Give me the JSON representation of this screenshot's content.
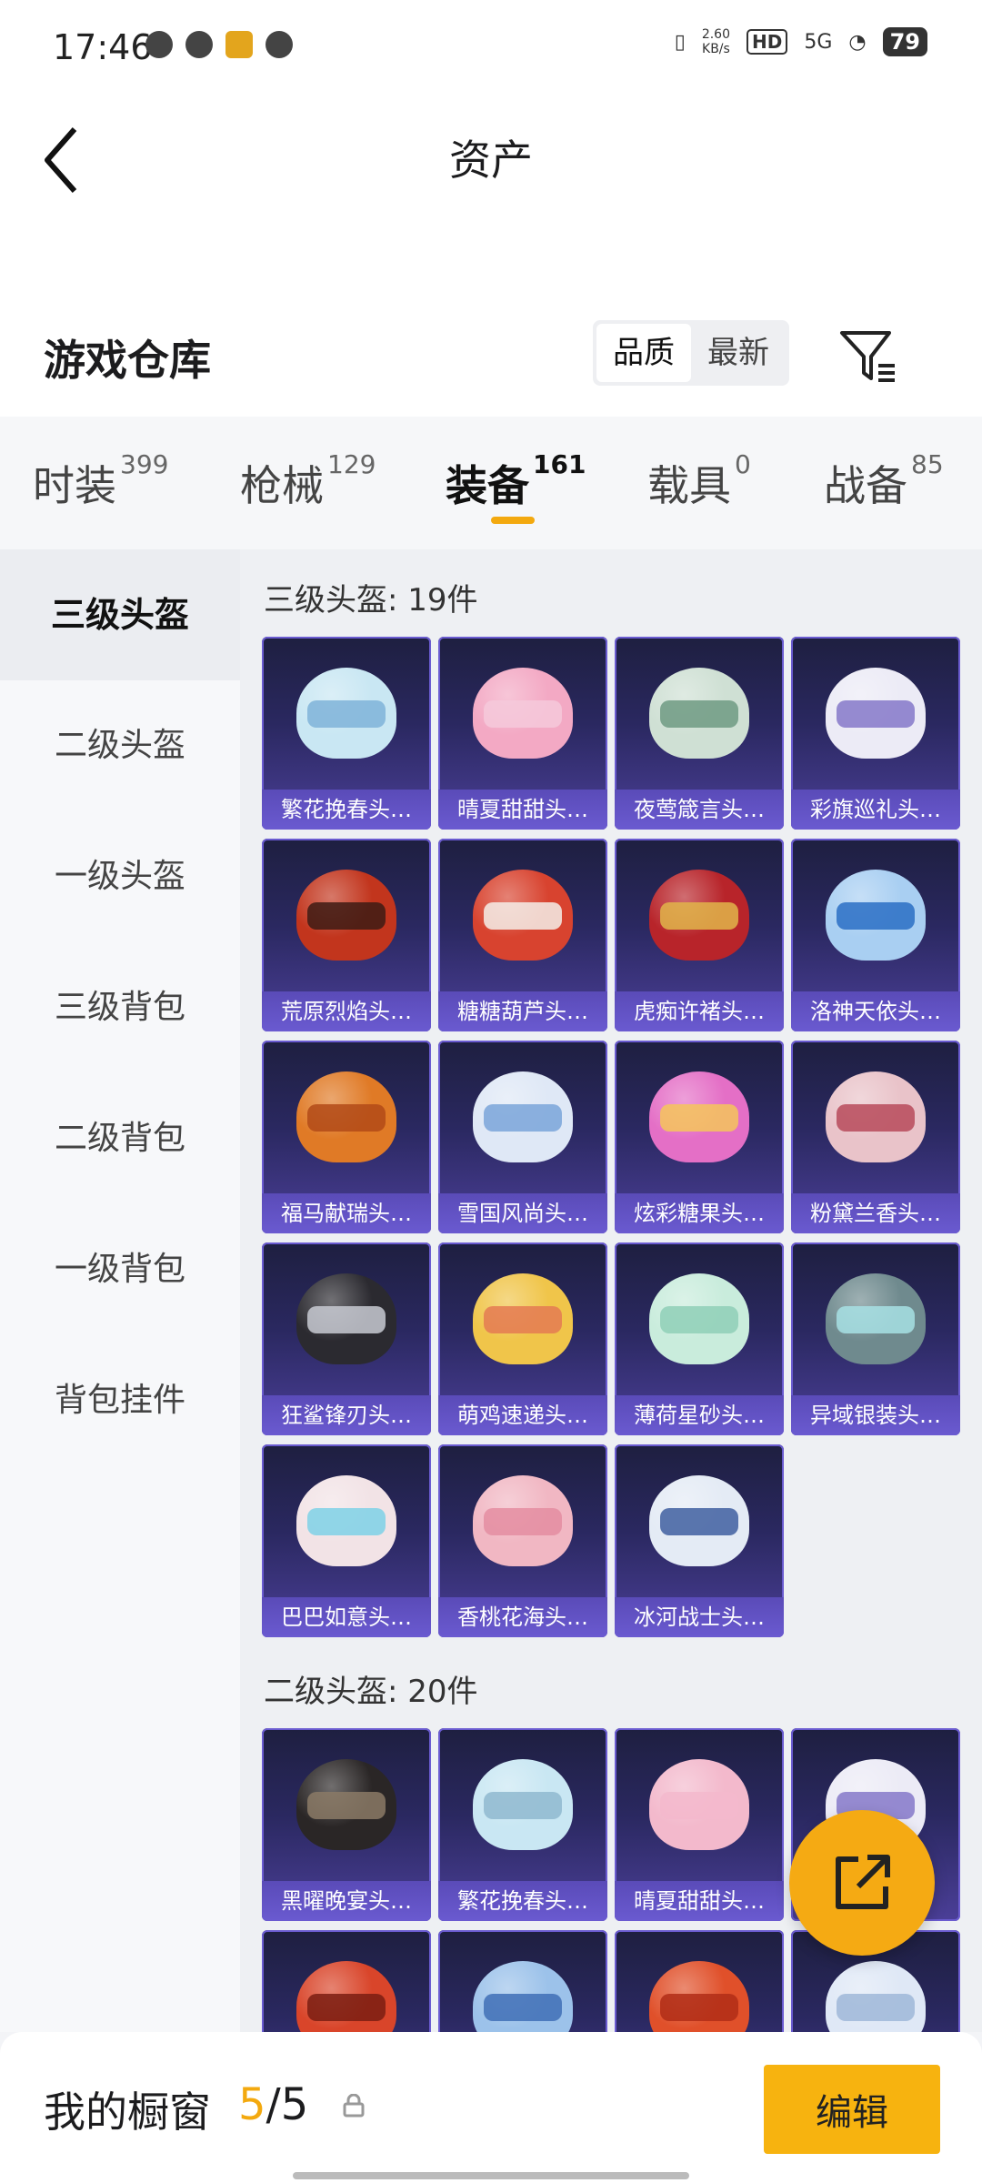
{
  "status": {
    "time": "17:46",
    "net_speed": "2.60",
    "net_unit": "KB/s",
    "hd": "HD",
    "signal": "5G",
    "battery": "79"
  },
  "header": {
    "title": "资产"
  },
  "warehouse": {
    "name": "游戏仓库",
    "sort_quality": "品质",
    "sort_latest": "最新"
  },
  "tabs": [
    {
      "label": "时装",
      "count": "399"
    },
    {
      "label": "枪械",
      "count": "129"
    },
    {
      "label": "装备",
      "count": "161"
    },
    {
      "label": "载具",
      "count": "0"
    },
    {
      "label": "战备",
      "count": "85"
    }
  ],
  "sidebar": [
    {
      "label": "三级头盔"
    },
    {
      "label": "二级头盔"
    },
    {
      "label": "一级头盔"
    },
    {
      "label": "三级背包"
    },
    {
      "label": "二级背包"
    },
    {
      "label": "一级背包"
    },
    {
      "label": "背包挂件"
    }
  ],
  "sections": [
    {
      "title": "三级头盔: 19件",
      "items": [
        {
          "name": "繁花挽春头…",
          "color": "#c9e7f3",
          "visor": "#7fb3d8"
        },
        {
          "name": "晴夏甜甜头…",
          "color": "#f3a9c4",
          "visor": "#f5c9db"
        },
        {
          "name": "夜莺箴言头…",
          "color": "#cfe0d4",
          "visor": "#6f9a82"
        },
        {
          "name": "彩旗巡礼头…",
          "color": "#ecebf6",
          "visor": "#8578c9"
        },
        {
          "name": "荒原烈焰头…",
          "color": "#c2351d",
          "visor": "#3d1b14"
        },
        {
          "name": "糖糖葫芦头…",
          "color": "#d8432f",
          "visor": "#f4efe9"
        },
        {
          "name": "虎痴许褚头…",
          "color": "#b8242a",
          "visor": "#e1b54a"
        },
        {
          "name": "洛神天依头…",
          "color": "#a9cff2",
          "visor": "#2a6fc4"
        },
        {
          "name": "福马献瑞头…",
          "color": "#e07a26",
          "visor": "#b24a18"
        },
        {
          "name": "雪国风尚头…",
          "color": "#dfe8f6",
          "visor": "#7aa4d9"
        },
        {
          "name": "炫彩糖果头…",
          "color": "#e46fc6",
          "visor": "#f4c55b"
        },
        {
          "name": "粉黛兰香头…",
          "color": "#e9c3c9",
          "visor": "#b74a5a"
        },
        {
          "name": "狂鲨锋刃头…",
          "color": "#2b2a30",
          "visor": "#c8cad2"
        },
        {
          "name": "萌鸡速递头…",
          "color": "#f0c54a",
          "visor": "#e47a52"
        },
        {
          "name": "薄荷星砂头…",
          "color": "#c9ecdc",
          "visor": "#8fcfb7"
        },
        {
          "name": "异域银装头…",
          "color": "#6f8a8e",
          "visor": "#a7e0e4"
        },
        {
          "name": "巴巴如意头…",
          "color": "#f2e3e6",
          "visor": "#7ed1e6"
        },
        {
          "name": "香桃花海头…",
          "color": "#f1b7c3",
          "visor": "#e48da1"
        },
        {
          "name": "冰河战士头…",
          "color": "#e4ebf5",
          "visor": "#3f5fa0"
        }
      ]
    },
    {
      "title": "二级头盔: 20件",
      "items": [
        {
          "name": "黑曜晚宴头…",
          "color": "#2a2626",
          "visor": "#8b7a66"
        },
        {
          "name": "繁花挽春头…",
          "color": "#c9e7f3",
          "visor": "#8fb9cf"
        },
        {
          "name": "晴夏甜甜头…",
          "color": "#f3b9cc",
          "visor": "#f3b9cc"
        },
        {
          "name": "",
          "color": "#ecebf6",
          "visor": "#8578c9"
        },
        {
          "name": "",
          "color": "#d9452a",
          "visor": "#7a1d12"
        },
        {
          "name": "",
          "color": "#9cc2ea",
          "visor": "#3f6fb6"
        },
        {
          "name": "",
          "color": "#e0502a",
          "visor": "#b02d16"
        },
        {
          "name": "",
          "color": "#dfe8f6",
          "visor": "#9fb7d8"
        }
      ]
    }
  ],
  "bottom": {
    "label": "我的橱窗",
    "count_current": "5",
    "count_sep": "/",
    "count_total": "5",
    "edit_label": "编辑"
  },
  "colors": {
    "accent": "#f3a90f",
    "card_border": "#6a5bd0",
    "edit_button": "#f7b30f"
  }
}
